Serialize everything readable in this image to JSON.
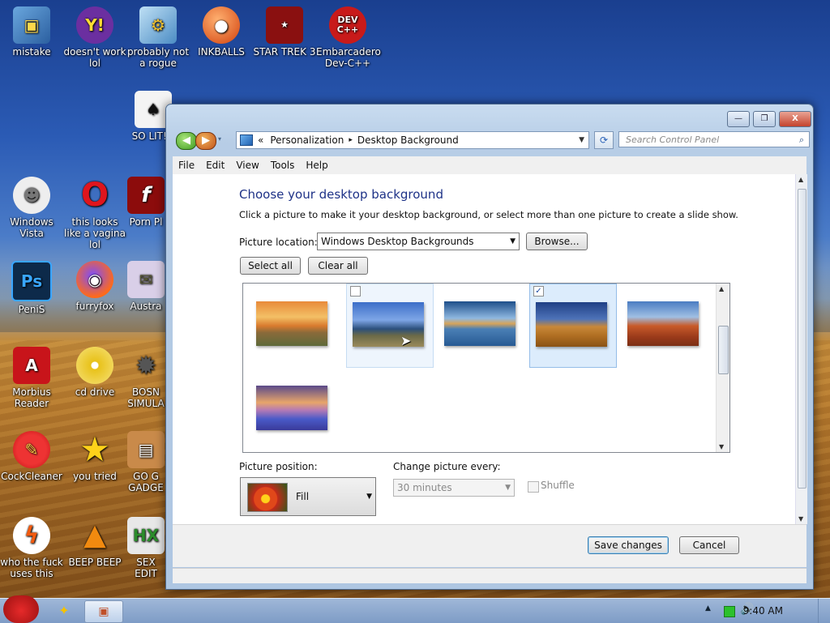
{
  "desktop": {
    "icons": [
      {
        "label": "mistake"
      },
      {
        "label": "doesn't work lol"
      },
      {
        "label": "probably not a rogue"
      },
      {
        "label": "INKBALLS"
      },
      {
        "label": "STAR TREK 3"
      },
      {
        "label": "Embarcadero Dev-C++"
      },
      {
        "label": "SO LIT!!!"
      },
      {
        "label": "Windows Vista"
      },
      {
        "label": "this looks like a vagina lol"
      },
      {
        "label": "Porn Pl"
      },
      {
        "label": "PeniS"
      },
      {
        "label": "furryfox"
      },
      {
        "label": "Austra"
      },
      {
        "label": "Morbius Reader"
      },
      {
        "label": "cd drive"
      },
      {
        "label": "BOSN SIMULA"
      },
      {
        "label": "CockCleaner"
      },
      {
        "label": "you tried"
      },
      {
        "label": "GO G GADGE"
      },
      {
        "label": "who the fuck uses this"
      },
      {
        "label": "BEEP BEEP"
      },
      {
        "label": "SEX EDIT"
      }
    ],
    "icon_glyphs": {
      "yahoo": "Y!",
      "devcpp": "DEV C++",
      "opera": "O",
      "flash": "f",
      "photoshop": "Ps",
      "acrobat": "A"
    }
  },
  "window": {
    "title_buttons": {
      "minimize": "—",
      "maximize": "❐",
      "close": "X"
    },
    "breadcrumb": {
      "prefix": "«",
      "items": [
        "Personalization",
        "Desktop Background"
      ],
      "separator": "▸"
    },
    "search_placeholder": "Search Control Panel",
    "menu": [
      "File",
      "Edit",
      "View",
      "Tools",
      "Help"
    ],
    "heading": "Choose your desktop background",
    "description": "Click a picture to make it your desktop background, or select more than one picture to create a slide show.",
    "picture_location_label": "Picture location:",
    "picture_location_value": "Windows Desktop Backgrounds",
    "browse_label": "Browse...",
    "select_all_label": "Select all",
    "clear_all_label": "Clear all",
    "thumbnails": [
      {
        "name": "sunset-fence",
        "checked": false,
        "state": "normal"
      },
      {
        "name": "lighthouse",
        "checked": false,
        "state": "hover"
      },
      {
        "name": "rock-arch-water",
        "checked": false,
        "state": "normal"
      },
      {
        "name": "hay-bale",
        "checked": true,
        "state": "selected"
      },
      {
        "name": "delicate-arch",
        "checked": false,
        "state": "normal"
      },
      {
        "name": "lake-flowers",
        "checked": false,
        "state": "normal"
      }
    ],
    "picture_position_label": "Picture position:",
    "picture_position_value": "Fill",
    "change_picture_label": "Change picture every:",
    "change_picture_value": "30 minutes",
    "shuffle_label": "Shuffle",
    "save_label": "Save changes",
    "cancel_label": "Cancel"
  },
  "taskbar": {
    "clock": "9:40 AM"
  },
  "colors": {
    "heading": "#1e3287",
    "selection": "#dcecfc",
    "accent": "#3c7fb1"
  }
}
